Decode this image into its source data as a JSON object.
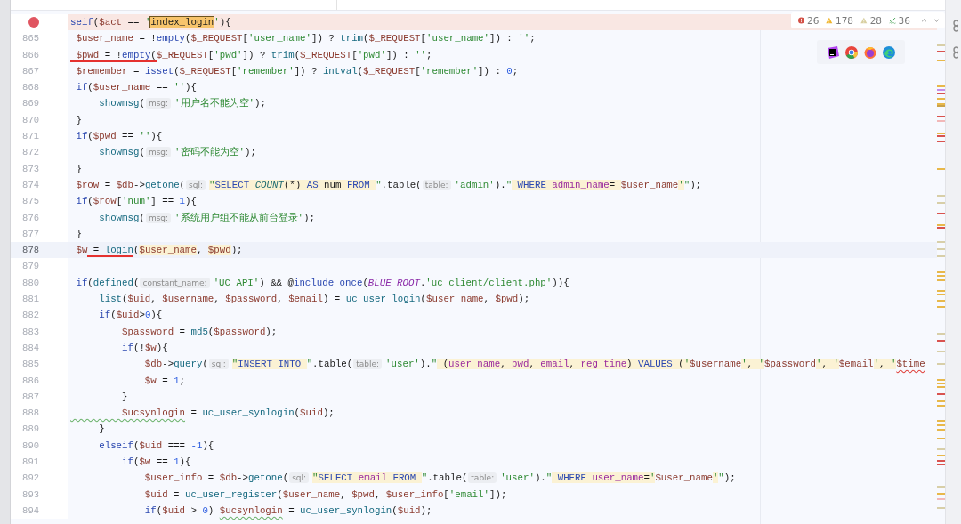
{
  "inspections": [
    {
      "kind": "error",
      "count": "26"
    },
    {
      "kind": "warning",
      "count": "178"
    },
    {
      "kind": "weak",
      "count": "28"
    },
    {
      "kind": "typo",
      "count": "36"
    }
  ],
  "lines": [
    {
      "breakpoint": true,
      "current": false,
      "tokens": [
        {
          "kind": "kw",
          "text": "seif"
        },
        {
          "kind": "p",
          "text": "("
        },
        {
          "kind": "var",
          "text": "$act"
        },
        {
          "kind": "p",
          "text": " == "
        },
        {
          "kind": "str",
          "text": "'"
        },
        {
          "kind": "match",
          "text": "index_login"
        },
        {
          "kind": "str",
          "text": "'"
        },
        {
          "kind": "p",
          "text": "){"
        }
      ]
    },
    {
      "number": "865",
      "breakpoint": false,
      "current": false,
      "tokens": [
        {
          "kind": "var",
          "text": " $user_name"
        },
        {
          "kind": "p",
          "text": " = !"
        },
        {
          "kind": "kw",
          "text": "empty"
        },
        {
          "kind": "p",
          "text": "("
        },
        {
          "kind": "var",
          "text": "$_REQUEST"
        },
        {
          "kind": "p",
          "text": "["
        },
        {
          "kind": "str",
          "text": "'user_name'"
        },
        {
          "kind": "p",
          "text": "]) ? "
        },
        {
          "kind": "fn",
          "text": "trim"
        },
        {
          "kind": "p",
          "text": "("
        },
        {
          "kind": "var",
          "text": "$_REQUEST"
        },
        {
          "kind": "p",
          "text": "["
        },
        {
          "kind": "str",
          "text": "'user_name'"
        },
        {
          "kind": "p",
          "text": "]) : "
        },
        {
          "kind": "str",
          "text": "''"
        },
        {
          "kind": "p",
          "text": ";"
        }
      ]
    },
    {
      "number": "866",
      "breakpoint": false,
      "current": false,
      "tokens": [
        {
          "kind": "var",
          "text": " $pwd",
          "underline": true
        },
        {
          "kind": "p",
          "text": " = !",
          "underline": true
        },
        {
          "kind": "kw",
          "text": "empty",
          "underline": true
        },
        {
          "kind": "p",
          "text": "(",
          "underline": true
        },
        {
          "kind": "var",
          "text": "$_REQUEST"
        },
        {
          "kind": "p",
          "text": "["
        },
        {
          "kind": "str",
          "text": "'pwd'"
        },
        {
          "kind": "p",
          "text": "]) ? "
        },
        {
          "kind": "fn",
          "text": "trim"
        },
        {
          "kind": "p",
          "text": "("
        },
        {
          "kind": "var",
          "text": "$_REQUEST"
        },
        {
          "kind": "p",
          "text": "["
        },
        {
          "kind": "str",
          "text": "'pwd'"
        },
        {
          "kind": "p",
          "text": "]) : "
        },
        {
          "kind": "str",
          "text": "''"
        },
        {
          "kind": "p",
          "text": ";"
        }
      ]
    },
    {
      "number": "867",
      "breakpoint": false,
      "current": false,
      "tokens": [
        {
          "kind": "var",
          "text": " $remember"
        },
        {
          "kind": "p",
          "text": " = "
        },
        {
          "kind": "kw",
          "text": "isset"
        },
        {
          "kind": "p",
          "text": "("
        },
        {
          "kind": "var",
          "text": "$_REQUEST"
        },
        {
          "kind": "p",
          "text": "["
        },
        {
          "kind": "str",
          "text": "'remember'"
        },
        {
          "kind": "p",
          "text": "]) ? "
        },
        {
          "kind": "fn",
          "text": "intval"
        },
        {
          "kind": "p",
          "text": "("
        },
        {
          "kind": "var",
          "text": "$_REQUEST"
        },
        {
          "kind": "p",
          "text": "["
        },
        {
          "kind": "str",
          "text": "'remember'"
        },
        {
          "kind": "p",
          "text": "]) : "
        },
        {
          "kind": "num",
          "text": "0"
        },
        {
          "kind": "p",
          "text": ";"
        }
      ]
    },
    {
      "number": "868",
      "breakpoint": false,
      "current": false,
      "tokens": [
        {
          "kind": "kw",
          "text": " if"
        },
        {
          "kind": "p",
          "text": "("
        },
        {
          "kind": "var",
          "text": "$user_name"
        },
        {
          "kind": "p",
          "text": " == "
        },
        {
          "kind": "str",
          "text": "''"
        },
        {
          "kind": "p",
          "text": "){"
        }
      ]
    },
    {
      "number": "869",
      "breakpoint": false,
      "current": false,
      "tokens": [
        {
          "kind": "fn",
          "text": "     showmsg"
        },
        {
          "kind": "p",
          "text": "("
        },
        {
          "kind": "hint",
          "text": "msg:"
        },
        {
          "kind": "str",
          "text": "'用户名不能为空'"
        },
        {
          "kind": "p",
          "text": ");"
        }
      ]
    },
    {
      "number": "870",
      "breakpoint": false,
      "current": false,
      "tokens": [
        {
          "kind": "p",
          "text": " }"
        }
      ]
    },
    {
      "number": "871",
      "breakpoint": false,
      "current": false,
      "tokens": [
        {
          "kind": "kw",
          "text": " if"
        },
        {
          "kind": "p",
          "text": "("
        },
        {
          "kind": "var",
          "text": "$pwd"
        },
        {
          "kind": "p",
          "text": " == "
        },
        {
          "kind": "str",
          "text": "''"
        },
        {
          "kind": "p",
          "text": "){"
        }
      ]
    },
    {
      "number": "872",
      "breakpoint": false,
      "current": false,
      "tokens": [
        {
          "kind": "fn",
          "text": "     showmsg"
        },
        {
          "kind": "p",
          "text": "("
        },
        {
          "kind": "hint",
          "text": "msg:"
        },
        {
          "kind": "str",
          "text": "'密码不能为空'"
        },
        {
          "kind": "p",
          "text": ");"
        }
      ]
    },
    {
      "number": "873",
      "breakpoint": false,
      "current": false,
      "tokens": [
        {
          "kind": "p",
          "text": " }"
        }
      ]
    },
    {
      "number": "874",
      "breakpoint": false,
      "current": false,
      "tokens": [
        {
          "kind": "var",
          "text": " $row"
        },
        {
          "kind": "p",
          "text": " = "
        },
        {
          "kind": "var",
          "text": "$db"
        },
        {
          "kind": "p",
          "text": "->"
        },
        {
          "kind": "fn",
          "text": "getone"
        },
        {
          "kind": "p",
          "text": "("
        },
        {
          "kind": "hint",
          "text": "sql:"
        },
        {
          "kind": "str",
          "text": "\"",
          "hl": true
        },
        {
          "kind": "sqlkw",
          "text": "SELECT ",
          "hl": true
        },
        {
          "kind": "sqlfn",
          "text": "COUNT",
          "hl": true
        },
        {
          "kind": "sqlp",
          "text": "(*) ",
          "hl": true
        },
        {
          "kind": "sqlkw",
          "text": "AS",
          "hl": true
        },
        {
          "kind": "sqlp",
          "text": " num ",
          "hl": true
        },
        {
          "kind": "sqlkw",
          "text": "FROM ",
          "hl": true
        },
        {
          "kind": "str",
          "text": "\""
        },
        {
          "kind": "p",
          "text": ".table("
        },
        {
          "kind": "hint",
          "text": "table:"
        },
        {
          "kind": "str",
          "text": "'admin'"
        },
        {
          "kind": "p",
          "text": ")."
        },
        {
          "kind": "str",
          "text": "\""
        },
        {
          "kind": "sqlkw",
          "text": " WHERE ",
          "hl": true
        },
        {
          "kind": "sqlid",
          "text": "admin_name",
          "hl": true
        },
        {
          "kind": "sqlp",
          "text": "=",
          "hl": true
        },
        {
          "kind": "str",
          "text": "'",
          "hl": true
        },
        {
          "kind": "var",
          "text": "$user_name"
        },
        {
          "kind": "str",
          "text": "'",
          "hl": true
        },
        {
          "kind": "str",
          "text": "\""
        },
        {
          "kind": "p",
          "text": ");"
        }
      ]
    },
    {
      "number": "875",
      "breakpoint": false,
      "current": false,
      "tokens": [
        {
          "kind": "kw",
          "text": " if"
        },
        {
          "kind": "p",
          "text": "("
        },
        {
          "kind": "var",
          "text": "$row"
        },
        {
          "kind": "p",
          "text": "["
        },
        {
          "kind": "str",
          "text": "'num'"
        },
        {
          "kind": "p",
          "text": "] == "
        },
        {
          "kind": "num",
          "text": "1"
        },
        {
          "kind": "p",
          "text": "){"
        }
      ]
    },
    {
      "number": "876",
      "breakpoint": false,
      "current": false,
      "tokens": [
        {
          "kind": "fn",
          "text": "     showmsg"
        },
        {
          "kind": "p",
          "text": "("
        },
        {
          "kind": "hint",
          "text": "msg:"
        },
        {
          "kind": "str",
          "text": "'系统用户组不能从前台登录'"
        },
        {
          "kind": "p",
          "text": ");"
        }
      ]
    },
    {
      "number": "877",
      "breakpoint": false,
      "current": false,
      "tokens": [
        {
          "kind": "p",
          "text": " }"
        }
      ]
    },
    {
      "number": "878",
      "breakpoint": false,
      "current": true,
      "tokens": [
        {
          "kind": "var",
          "text": " $w"
        },
        {
          "kind": "p",
          "text": " = ",
          "underline": true
        },
        {
          "kind": "fn",
          "text": "login",
          "underline": true
        },
        {
          "kind": "p",
          "text": "("
        },
        {
          "kind": "var",
          "text": "$user_name",
          "hl": true
        },
        {
          "kind": "p",
          "text": ", "
        },
        {
          "kind": "var",
          "text": "$pwd",
          "hl": true
        },
        {
          "kind": "p",
          "text": ");"
        }
      ]
    },
    {
      "number": "879",
      "breakpoint": false,
      "current": false
    },
    {
      "number": "880",
      "breakpoint": false,
      "current": false,
      "tokens": [
        {
          "kind": "kw",
          "text": " if"
        },
        {
          "kind": "p",
          "text": "("
        },
        {
          "kind": "fn",
          "text": "defined"
        },
        {
          "kind": "p",
          "text": "("
        },
        {
          "kind": "hint",
          "text": "constant_name:"
        },
        {
          "kind": "str",
          "text": "'UC_API'"
        },
        {
          "kind": "p",
          "text": ") && @"
        },
        {
          "kind": "kw",
          "text": "include_once"
        },
        {
          "kind": "p",
          "text": "("
        },
        {
          "kind": "const",
          "text": "BLUE_ROOT"
        },
        {
          "kind": "p",
          "text": "."
        },
        {
          "kind": "str",
          "text": "'uc_client/client.php'"
        },
        {
          "kind": "p",
          "text": ")){"
        }
      ]
    },
    {
      "number": "881",
      "breakpoint": false,
      "current": false,
      "tokens": [
        {
          "kind": "fn",
          "text": "     list"
        },
        {
          "kind": "p",
          "text": "("
        },
        {
          "kind": "var",
          "text": "$uid"
        },
        {
          "kind": "p",
          "text": ", "
        },
        {
          "kind": "var",
          "text": "$username"
        },
        {
          "kind": "p",
          "text": ", "
        },
        {
          "kind": "var",
          "text": "$password"
        },
        {
          "kind": "p",
          "text": ", "
        },
        {
          "kind": "var",
          "text": "$email"
        },
        {
          "kind": "p",
          "text": ") = "
        },
        {
          "kind": "fn",
          "text": "uc_user_login"
        },
        {
          "kind": "p",
          "text": "("
        },
        {
          "kind": "var",
          "text": "$user_name"
        },
        {
          "kind": "p",
          "text": ", "
        },
        {
          "kind": "var",
          "text": "$pwd"
        },
        {
          "kind": "p",
          "text": ");"
        }
      ]
    },
    {
      "number": "882",
      "breakpoint": false,
      "current": false,
      "tokens": [
        {
          "kind": "kw",
          "text": "     if"
        },
        {
          "kind": "p",
          "text": "("
        },
        {
          "kind": "var",
          "text": "$uid"
        },
        {
          "kind": "p",
          "text": ">"
        },
        {
          "kind": "num",
          "text": "0"
        },
        {
          "kind": "p",
          "text": "){"
        }
      ]
    },
    {
      "number": "883",
      "breakpoint": false,
      "current": false,
      "tokens": [
        {
          "kind": "var",
          "text": "         $password"
        },
        {
          "kind": "p",
          "text": " = "
        },
        {
          "kind": "fn",
          "text": "md5"
        },
        {
          "kind": "p",
          "text": "("
        },
        {
          "kind": "var",
          "text": "$password"
        },
        {
          "kind": "p",
          "text": ");"
        }
      ]
    },
    {
      "number": "884",
      "breakpoint": false,
      "current": false,
      "tokens": [
        {
          "kind": "kw",
          "text": "         if"
        },
        {
          "kind": "p",
          "text": "(!"
        },
        {
          "kind": "var",
          "text": "$w"
        },
        {
          "kind": "p",
          "text": "){"
        }
      ]
    },
    {
      "number": "885",
      "breakpoint": false,
      "current": false,
      "tokens": [
        {
          "kind": "var",
          "text": "             $db"
        },
        {
          "kind": "p",
          "text": "->"
        },
        {
          "kind": "fn",
          "text": "query"
        },
        {
          "kind": "p",
          "text": "("
        },
        {
          "kind": "hint",
          "text": "sql:"
        },
        {
          "kind": "str",
          "text": "\"",
          "hl": true
        },
        {
          "kind": "sqlkw",
          "text": "INSERT INTO ",
          "hl": true
        },
        {
          "kind": "str",
          "text": "\""
        },
        {
          "kind": "p",
          "text": ".table("
        },
        {
          "kind": "hint",
          "text": "table:"
        },
        {
          "kind": "str",
          "text": "'user'"
        },
        {
          "kind": "p",
          "text": ")."
        },
        {
          "kind": "str",
          "text": "\""
        },
        {
          "kind": "sqlp",
          "text": " (",
          "hl": true
        },
        {
          "kind": "sqlid",
          "text": "user_name",
          "hl": true
        },
        {
          "kind": "sqlp",
          "text": ", ",
          "hl": true
        },
        {
          "kind": "sqlid",
          "text": "pwd",
          "hl": true
        },
        {
          "kind": "sqlp",
          "text": ", ",
          "hl": true
        },
        {
          "kind": "sqlid",
          "text": "email",
          "hl": true
        },
        {
          "kind": "sqlp",
          "text": ", ",
          "hl": true
        },
        {
          "kind": "sqlid",
          "text": "reg_time",
          "hl": true
        },
        {
          "kind": "sqlp",
          "text": ") ",
          "hl": true
        },
        {
          "kind": "sqlkw",
          "text": "VALUES",
          "hl": true
        },
        {
          "kind": "sqlp",
          "text": " (",
          "hl": true
        },
        {
          "kind": "str",
          "text": "'",
          "hl": true
        },
        {
          "kind": "var",
          "text": "$username"
        },
        {
          "kind": "str",
          "text": "'",
          "hl": true
        },
        {
          "kind": "sqlp",
          "text": ", ",
          "hl": true
        },
        {
          "kind": "str",
          "text": "'",
          "hl": true
        },
        {
          "kind": "var",
          "text": "$password"
        },
        {
          "kind": "str",
          "text": "'",
          "hl": true
        },
        {
          "kind": "sqlp",
          "text": ", ",
          "hl": true
        },
        {
          "kind": "str",
          "text": "'",
          "hl": true
        },
        {
          "kind": "var",
          "text": "$email"
        },
        {
          "kind": "str",
          "text": "'",
          "hl": true
        },
        {
          "kind": "sqlp",
          "text": ", ",
          "hl": true
        },
        {
          "kind": "str",
          "text": "'",
          "hl": true
        },
        {
          "kind": "var",
          "text": "$time",
          "error": true
        }
      ]
    },
    {
      "number": "886",
      "breakpoint": false,
      "current": false,
      "tokens": [
        {
          "kind": "var",
          "text": "             $w"
        },
        {
          "kind": "p",
          "text": " = "
        },
        {
          "kind": "num",
          "text": "1"
        },
        {
          "kind": "p",
          "text": ";"
        }
      ]
    },
    {
      "number": "887",
      "breakpoint": false,
      "current": false,
      "tokens": [
        {
          "kind": "p",
          "text": "         }"
        }
      ]
    },
    {
      "number": "888",
      "breakpoint": false,
      "current": false,
      "tokens": [
        {
          "kind": "var",
          "text": "         $ucsynlogin",
          "typo": true
        },
        {
          "kind": "p",
          "text": " = "
        },
        {
          "kind": "fn",
          "text": "uc_user_synlogin"
        },
        {
          "kind": "p",
          "text": "("
        },
        {
          "kind": "var",
          "text": "$uid"
        },
        {
          "kind": "p",
          "text": ");"
        }
      ]
    },
    {
      "number": "889",
      "breakpoint": false,
      "current": false,
      "tokens": [
        {
          "kind": "p",
          "text": "     }"
        }
      ]
    },
    {
      "number": "890",
      "breakpoint": false,
      "current": false,
      "tokens": [
        {
          "kind": "kw",
          "text": "     elseif"
        },
        {
          "kind": "p",
          "text": "("
        },
        {
          "kind": "var",
          "text": "$uid"
        },
        {
          "kind": "p",
          "text": " === "
        },
        {
          "kind": "num",
          "text": "-1"
        },
        {
          "kind": "p",
          "text": "){"
        }
      ]
    },
    {
      "number": "891",
      "breakpoint": false,
      "current": false,
      "tokens": [
        {
          "kind": "kw",
          "text": "         if"
        },
        {
          "kind": "p",
          "text": "("
        },
        {
          "kind": "var",
          "text": "$w"
        },
        {
          "kind": "p",
          "text": " == "
        },
        {
          "kind": "num",
          "text": "1"
        },
        {
          "kind": "p",
          "text": "){"
        }
      ]
    },
    {
      "number": "892",
      "breakpoint": false,
      "current": false,
      "tokens": [
        {
          "kind": "var",
          "text": "             $user_info"
        },
        {
          "kind": "p",
          "text": " = "
        },
        {
          "kind": "var",
          "text": "$db"
        },
        {
          "kind": "p",
          "text": "->"
        },
        {
          "kind": "fn",
          "text": "getone"
        },
        {
          "kind": "p",
          "text": "("
        },
        {
          "kind": "hint",
          "text": "sql:"
        },
        {
          "kind": "str",
          "text": "\"",
          "hl": true
        },
        {
          "kind": "sqlkw",
          "text": "SELECT ",
          "hl": true
        },
        {
          "kind": "sqlid",
          "text": "email ",
          "hl": true
        },
        {
          "kind": "sqlkw",
          "text": "FROM ",
          "hl": true
        },
        {
          "kind": "str",
          "text": "\""
        },
        {
          "kind": "p",
          "text": ".table("
        },
        {
          "kind": "hint",
          "text": "table:"
        },
        {
          "kind": "str",
          "text": "'user'"
        },
        {
          "kind": "p",
          "text": ")."
        },
        {
          "kind": "str",
          "text": "\""
        },
        {
          "kind": "sqlkw",
          "text": " WHERE ",
          "hl": true
        },
        {
          "kind": "sqlid",
          "text": "user_name",
          "hl": true
        },
        {
          "kind": "sqlp",
          "text": "=",
          "hl": true
        },
        {
          "kind": "str",
          "text": "'",
          "hl": true
        },
        {
          "kind": "var",
          "text": "$user_name"
        },
        {
          "kind": "str",
          "text": "'",
          "hl": true
        },
        {
          "kind": "str",
          "text": "\""
        },
        {
          "kind": "p",
          "text": ");"
        }
      ]
    },
    {
      "number": "893",
      "breakpoint": false,
      "current": false,
      "tokens": [
        {
          "kind": "var",
          "text": "             $uid"
        },
        {
          "kind": "p",
          "text": " = "
        },
        {
          "kind": "fn",
          "text": "uc_user_register"
        },
        {
          "kind": "p",
          "text": "("
        },
        {
          "kind": "var",
          "text": "$user_name"
        },
        {
          "kind": "p",
          "text": ", "
        },
        {
          "kind": "var",
          "text": "$pwd"
        },
        {
          "kind": "p",
          "text": ", "
        },
        {
          "kind": "var",
          "text": "$user_info"
        },
        {
          "kind": "p",
          "text": "["
        },
        {
          "kind": "str",
          "text": "'email'"
        },
        {
          "kind": "p",
          "text": "]);"
        }
      ]
    },
    {
      "number": "894",
      "breakpoint": false,
      "current": false,
      "tokens": [
        {
          "kind": "kw",
          "text": "             if"
        },
        {
          "kind": "p",
          "text": "("
        },
        {
          "kind": "var",
          "text": "$uid"
        },
        {
          "kind": "p",
          "text": " > "
        },
        {
          "kind": "num",
          "text": "0"
        },
        {
          "kind": "p",
          "text": ") "
        },
        {
          "kind": "var",
          "text": "$ucsynlogin",
          "typo": true
        },
        {
          "kind": "p",
          "text": " = "
        },
        {
          "kind": "fn",
          "text": "uc_user_synlogin"
        },
        {
          "kind": "p",
          "text": "("
        },
        {
          "kind": "var",
          "text": "$uid"
        },
        {
          "kind": "p",
          "text": ");"
        }
      ]
    }
  ]
}
